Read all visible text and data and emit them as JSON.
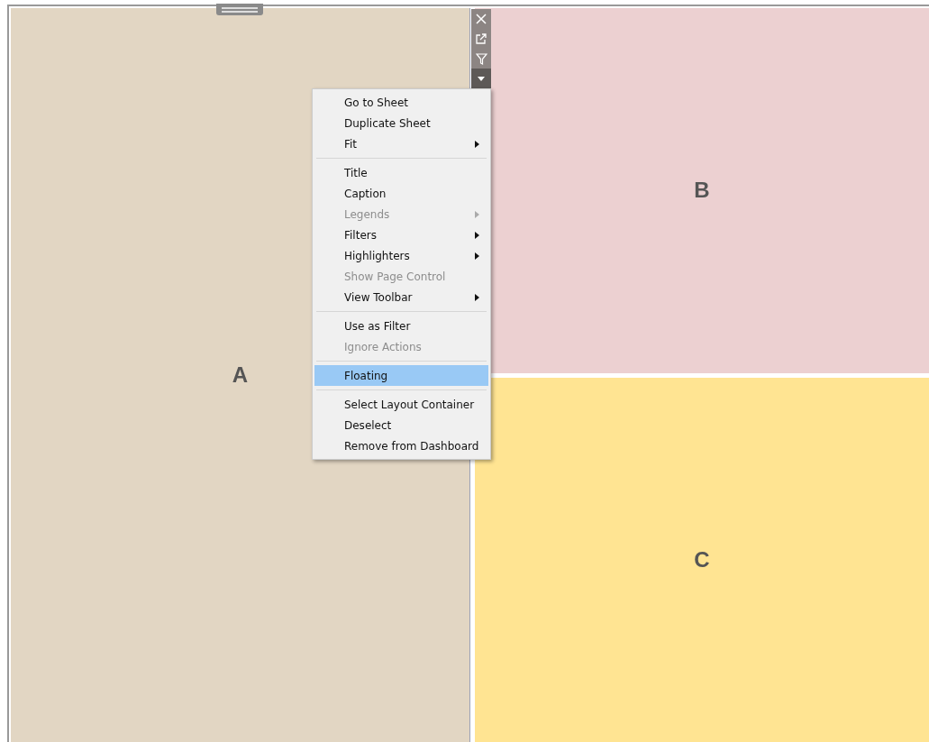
{
  "panels": [
    {
      "label": "A",
      "color": "#e2d6c3"
    },
    {
      "label": "B",
      "color": "#ecd0d1"
    },
    {
      "label": "C",
      "color": "#ffe492"
    }
  ],
  "context_menu": {
    "items": [
      {
        "kind": "item",
        "label": "Go to Sheet",
        "disabled": false,
        "submenu": false,
        "selected": false
      },
      {
        "kind": "item",
        "label": "Duplicate Sheet",
        "disabled": false,
        "submenu": false,
        "selected": false
      },
      {
        "kind": "item",
        "label": "Fit",
        "disabled": false,
        "submenu": true,
        "selected": false
      },
      {
        "kind": "separator"
      },
      {
        "kind": "item",
        "label": "Title",
        "disabled": false,
        "submenu": false,
        "selected": false
      },
      {
        "kind": "item",
        "label": "Caption",
        "disabled": false,
        "submenu": false,
        "selected": false
      },
      {
        "kind": "item",
        "label": "Legends",
        "disabled": true,
        "submenu": true,
        "selected": false
      },
      {
        "kind": "item",
        "label": "Filters",
        "disabled": false,
        "submenu": true,
        "selected": false
      },
      {
        "kind": "item",
        "label": "Highlighters",
        "disabled": false,
        "submenu": true,
        "selected": false
      },
      {
        "kind": "item",
        "label": "Show Page Control",
        "disabled": true,
        "submenu": false,
        "selected": false
      },
      {
        "kind": "item",
        "label": "View Toolbar",
        "disabled": false,
        "submenu": true,
        "selected": false
      },
      {
        "kind": "separator"
      },
      {
        "kind": "item",
        "label": "Use as Filter",
        "disabled": false,
        "submenu": false,
        "selected": false
      },
      {
        "kind": "item",
        "label": "Ignore Actions",
        "disabled": true,
        "submenu": false,
        "selected": false
      },
      {
        "kind": "separator"
      },
      {
        "kind": "item",
        "label": "Floating",
        "disabled": false,
        "submenu": false,
        "selected": true
      },
      {
        "kind": "separator"
      },
      {
        "kind": "item",
        "label": "Select Layout Container",
        "disabled": false,
        "submenu": false,
        "selected": false
      },
      {
        "kind": "item",
        "label": "Deselect",
        "disabled": false,
        "submenu": false,
        "selected": false
      },
      {
        "kind": "item",
        "label": "Remove from Dashboard",
        "disabled": false,
        "submenu": false,
        "selected": false
      }
    ]
  }
}
